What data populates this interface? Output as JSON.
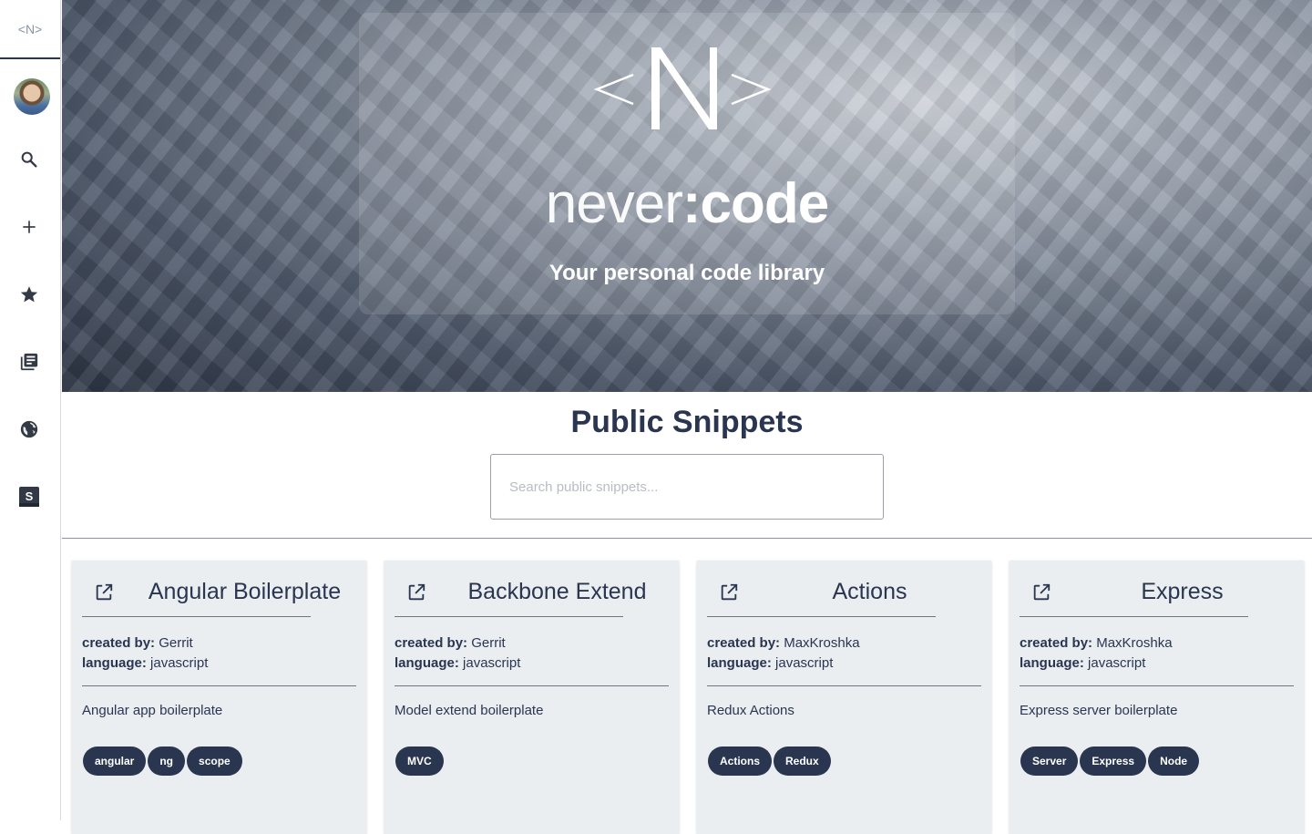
{
  "sidebar": {
    "logo": "<N>",
    "items": [
      {
        "name": "search-icon"
      },
      {
        "name": "add-icon"
      },
      {
        "name": "star-icon"
      },
      {
        "name": "library-icon"
      },
      {
        "name": "globe-icon"
      },
      {
        "name": "snippet-s-icon"
      }
    ]
  },
  "hero": {
    "mark": "<N>",
    "title_thin": "never",
    "title_bold": ":code",
    "subtitle": "Your personal code library"
  },
  "main": {
    "title": "Public Snippets",
    "search": {
      "placeholder": "Search public snippets...",
      "value": ""
    }
  },
  "labels": {
    "created_by": "created by:",
    "language": "language:"
  },
  "cards": [
    {
      "title": "Angular Boilerplate",
      "author": "Gerrit",
      "language": "javascript",
      "description": "Angular app boilerplate",
      "tags": [
        "angular",
        "ng",
        "scope"
      ]
    },
    {
      "title": "Backbone Extend",
      "author": "Gerrit",
      "language": "javascript",
      "description": "Model extend boilerplate",
      "tags": [
        "MVC"
      ]
    },
    {
      "title": "Actions",
      "author": "MaxKroshka",
      "language": "javascript",
      "description": "Redux Actions",
      "tags": [
        "Actions",
        "Redux"
      ]
    },
    {
      "title": "Express",
      "author": "MaxKroshka",
      "language": "javascript",
      "description": "Express server boilerplate",
      "tags": [
        "Server",
        "Express",
        "Node"
      ]
    }
  ],
  "colors": {
    "primary": "#2a3550",
    "card_bg": "#eaeef1"
  }
}
